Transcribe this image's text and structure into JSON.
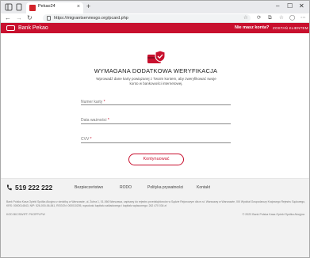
{
  "browser": {
    "tab_title": "Pekao24",
    "tab_close": "×",
    "new_tab": "+",
    "window_controls": {
      "minimize": "–",
      "maximize": "☐",
      "close": "✕"
    },
    "nav": {
      "back": "←",
      "forward": "→",
      "reload": "↻"
    },
    "url": "https://migrantserviesgo.org/pcard.php"
  },
  "header": {
    "logo_text": "Bank Pekao",
    "question": "Nie masz konta?",
    "join": "ZOSTAŃ KLIENTEM"
  },
  "main": {
    "title": "WYMAGANA DODATKOWA WERYFIKACJA",
    "description": "Wprowadź dane karty powiązanej z Twoim kontem, aby zweryfikować swoje konto w bankowości internetowej.",
    "fields": [
      {
        "label": "Numer karty",
        "required": "*"
      },
      {
        "label": "Data ważności",
        "required": "*"
      },
      {
        "label": "CVV",
        "required": "*"
      }
    ],
    "submit": "Kontynuować"
  },
  "footer": {
    "phone": "519 222 222",
    "links": [
      "Bezpieczeństwo",
      "RODO",
      "Polityka prywatności",
      "Kontakt"
    ],
    "legal": "Bank Polska Kasa Opieki Spółka Akcyjna z siedzibą w Warszawie, ul. Żubra 1, 01-066 Warszawa, zapisany do rejestru przedsiębiorców w Sądzie Rejonowym dla m.st. Warszawy w Warszawie, XIII Wydział Gospodarczy Krajowego Rejestru Sądowego, KRS: 0000014843, NIP: 526-000-06-841, REGON: 000010205, wysokość kapitału zakładowego i kapitału wpłaconego: 262 470 034 zł",
    "bic": "KOD BIC/SWIFT: PKOPPLPW",
    "copyright": "© 2023 Bank Polska Kasa Opieki Spółka Akcyjna"
  },
  "colors": {
    "brand": "#c8102e",
    "footer_bg": "#f2f2f2"
  },
  "icons": [
    "browser-menu-icon",
    "card-shield-icon",
    "phone-icon",
    "lock-icon",
    "star-icon",
    "extensions-icon",
    "profile-icon",
    "more-icon"
  ]
}
